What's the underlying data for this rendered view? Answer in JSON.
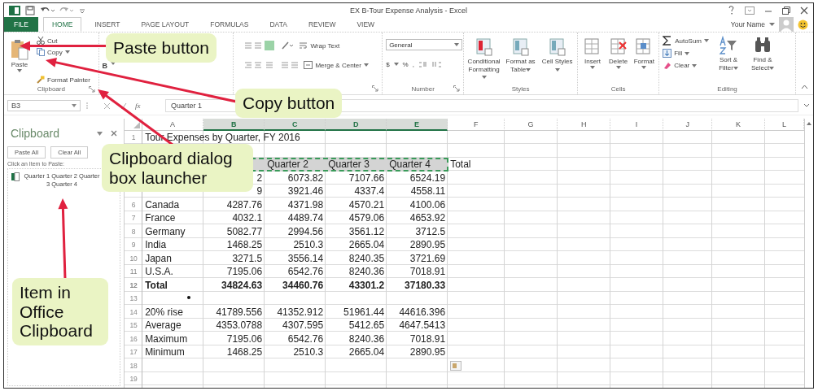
{
  "window": {
    "title": "EX B-Tour Expense Analysis - Excel"
  },
  "ribbon_tabs": [
    {
      "label": "FILE",
      "kind": "file",
      "selected": false
    },
    {
      "label": "HOME",
      "kind": "tab",
      "selected": true
    },
    {
      "label": "INSERT",
      "kind": "tab",
      "selected": false
    },
    {
      "label": "PAGE LAYOUT",
      "kind": "tab",
      "selected": false
    },
    {
      "label": "FORMULAS",
      "kind": "tab",
      "selected": false
    },
    {
      "label": "DATA",
      "kind": "tab",
      "selected": false
    },
    {
      "label": "REVIEW",
      "kind": "tab",
      "selected": false
    },
    {
      "label": "VIEW",
      "kind": "tab",
      "selected": false
    }
  ],
  "account": {
    "name": "Your Name"
  },
  "ribbon": {
    "clipboard": {
      "paste": "Paste",
      "cut": "Cut",
      "copy": "Copy",
      "format_painter": "Format Painter",
      "label": "Clipboard"
    },
    "font": {
      "bold": "B"
    },
    "alignment": {
      "wrap_text": "Wrap Text",
      "merge_center": "Merge & Center"
    },
    "number": {
      "format": "General",
      "currency": "$",
      "percent": "%",
      "comma": ",",
      "label": "Number"
    },
    "styles": {
      "items": [
        "Conditional Formatting",
        "Format as Table",
        "Cell Styles"
      ],
      "label": "Styles"
    },
    "cells": {
      "items": [
        "Insert",
        "Delete",
        "Format"
      ],
      "label": "Cells"
    },
    "editing": {
      "autosum": "AutoSum",
      "fill": "Fill",
      "clear": "Clear",
      "sort": "Sort & Filter",
      "find": "Find & Select",
      "label": "Editing"
    }
  },
  "formula_bar": {
    "name_box": "B3",
    "fx": "fx",
    "value": "Quarter 1"
  },
  "clipboard_pane": {
    "title": "Clipboard",
    "buttons": [
      "Paste All",
      "Clear All"
    ],
    "hint": "Click an Item to Paste:",
    "items": [
      "Quarter 1 Quarter 2 Quarter 3 Quarter 4"
    ]
  },
  "sheet": {
    "columns": [
      {
        "label": "A",
        "selected": false
      },
      {
        "label": "B",
        "selected": true
      },
      {
        "label": "C",
        "selected": true
      },
      {
        "label": "D",
        "selected": true
      },
      {
        "label": "E",
        "selected": true
      },
      {
        "label": "F",
        "selected": false
      },
      {
        "label": "G",
        "selected": false
      },
      {
        "label": "H",
        "selected": false
      },
      {
        "label": "I",
        "selected": false
      },
      {
        "label": "J",
        "selected": false
      },
      {
        "label": "K",
        "selected": false
      },
      {
        "label": "L",
        "selected": false
      }
    ],
    "rows": [
      {
        "num": "1",
        "kind": "title",
        "label": "Tour Expenses by Quarter, FY 2016",
        "copied": false
      },
      {
        "kind": "blank",
        "copied": false
      },
      {
        "kind": "header",
        "c": "Quarter 2",
        "d": "Quarter 3",
        "e": "Quarter 4",
        "total": "Total",
        "copied": true
      },
      {
        "kind": "data",
        "b": "2",
        "c": "6073.82",
        "d": "7107.66",
        "e": "6524.19",
        "copied": false
      },
      {
        "kind": "data",
        "b": "9",
        "c": "3921.46",
        "d": "4337.4",
        "e": "4558.11",
        "copied": false
      },
      {
        "num": "6",
        "kind": "data",
        "label": "Canada",
        "b": "4287.76",
        "c": "4371.98",
        "d": "4570.21",
        "e": "4100.06",
        "copied": false
      },
      {
        "num": "7",
        "kind": "data",
        "label": "France",
        "b": "4032.1",
        "c": "4489.74",
        "d": "4579.06",
        "e": "4653.92",
        "copied": false
      },
      {
        "num": "8",
        "kind": "data",
        "label": "Germany",
        "b": "5082.77",
        "c": "2994.56",
        "d": "3561.12",
        "e": "3712.5",
        "copied": false
      },
      {
        "num": "9",
        "kind": "data",
        "label": "India",
        "b": "1468.25",
        "c": "2510.3",
        "d": "2665.04",
        "e": "2890.95",
        "copied": false
      },
      {
        "num": "10",
        "kind": "data",
        "label": "Japan",
        "b": "3271.5",
        "c": "3556.14",
        "d": "8240.35",
        "e": "3721.69",
        "copied": false
      },
      {
        "num": "11",
        "kind": "data",
        "label": "U.S.A.",
        "b": "7195.06",
        "c": "6542.76",
        "d": "8240.36",
        "e": "7018.91",
        "copied": false
      },
      {
        "num": "12",
        "kind": "total",
        "label": "Total",
        "b": "34824.63",
        "c": "34460.76",
        "d": "43301.2",
        "e": "37180.33",
        "copied": false
      },
      {
        "num": "13",
        "kind": "blank",
        "copied": false
      },
      {
        "num": "14",
        "kind": "data",
        "label": "20% rise",
        "b": "41789.556",
        "c": "41352.912",
        "d": "51961.44",
        "e": "44616.396",
        "copied": false
      },
      {
        "num": "15",
        "kind": "data",
        "label": "Average",
        "b": "4353.0788",
        "c": "4307.595",
        "d": "5412.65",
        "e": "4647.5413",
        "copied": false
      },
      {
        "num": "16",
        "kind": "data",
        "label": "Maximum",
        "b": "7195.06",
        "c": "6542.76",
        "d": "8240.36",
        "e": "7018.91",
        "copied": false
      },
      {
        "num": "17",
        "kind": "data",
        "label": "Minimum",
        "b": "1468.25",
        "c": "2510.3",
        "d": "2665.04",
        "e": "2890.95",
        "copied": false
      },
      {
        "num": "18",
        "kind": "blank",
        "paste_options": true,
        "copied": false
      },
      {
        "num": "19",
        "kind": "blank",
        "copied": false
      }
    ]
  },
  "callouts": [
    {
      "text": "Paste button"
    },
    {
      "text": "Copy button"
    },
    {
      "text": "Clipboard dialog box launcher"
    },
    {
      "text": "Item in Office Clipboard"
    }
  ]
}
